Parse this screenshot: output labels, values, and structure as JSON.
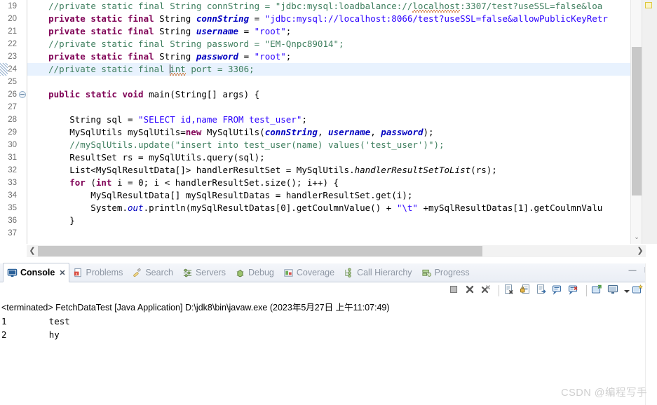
{
  "editor": {
    "first_visible_line_partial": "18",
    "cursor_line": "24",
    "lines": [
      {
        "num": "19",
        "fold": false,
        "changed": false,
        "highlight": false,
        "tokens": [
          {
            "t": "    ",
            "c": "plain"
          },
          {
            "t": "//private static final String connString = \"jdbc:mysql:loadbalance://",
            "c": "cmt"
          },
          {
            "t": "localhost",
            "c": "cmt spell"
          },
          {
            "t": ":3307/test?useSSL=false&loa",
            "c": "cmt"
          }
        ]
      },
      {
        "num": "20",
        "fold": false,
        "changed": false,
        "highlight": false,
        "tokens": [
          {
            "t": "    ",
            "c": "plain"
          },
          {
            "t": "private static final ",
            "c": "kw"
          },
          {
            "t": "String ",
            "c": "plain"
          },
          {
            "t": "connString",
            "c": "fld"
          },
          {
            "t": " = ",
            "c": "plain"
          },
          {
            "t": "\"jdbc:mysql://localhost:8066/test?useSSL=false&allowPublicKeyRetr",
            "c": "str"
          }
        ]
      },
      {
        "num": "21",
        "fold": false,
        "changed": false,
        "highlight": false,
        "tokens": [
          {
            "t": "    ",
            "c": "plain"
          },
          {
            "t": "private static final ",
            "c": "kw"
          },
          {
            "t": "String ",
            "c": "plain"
          },
          {
            "t": "username",
            "c": "fld"
          },
          {
            "t": " = ",
            "c": "plain"
          },
          {
            "t": "\"root\"",
            "c": "str"
          },
          {
            "t": ";",
            "c": "plain"
          }
        ]
      },
      {
        "num": "22",
        "fold": false,
        "changed": false,
        "highlight": false,
        "tokens": [
          {
            "t": "    ",
            "c": "plain"
          },
          {
            "t": "//private static final String password = \"EM-Qnpc89014\";",
            "c": "cmt"
          }
        ]
      },
      {
        "num": "23",
        "fold": false,
        "changed": false,
        "highlight": false,
        "tokens": [
          {
            "t": "    ",
            "c": "plain"
          },
          {
            "t": "private static final ",
            "c": "kw"
          },
          {
            "t": "String ",
            "c": "plain"
          },
          {
            "t": "password",
            "c": "fld"
          },
          {
            "t": " = ",
            "c": "plain"
          },
          {
            "t": "\"root\"",
            "c": "str"
          },
          {
            "t": ";",
            "c": "plain"
          }
        ]
      },
      {
        "num": "24",
        "fold": false,
        "changed": true,
        "highlight": true,
        "caret_after": 2,
        "tokens": [
          {
            "t": "    ",
            "c": "plain"
          },
          {
            "t": "//",
            "c": "cmt"
          },
          {
            "t": "private static final ",
            "c": "cmt"
          },
          {
            "t": "int",
            "c": "cmt spell"
          },
          {
            "t": " port = 3306;",
            "c": "cmt"
          }
        ]
      },
      {
        "num": "25",
        "fold": false,
        "changed": false,
        "highlight": false,
        "tokens": [
          {
            "t": "",
            "c": "plain"
          }
        ]
      },
      {
        "num": "26",
        "fold": true,
        "changed": false,
        "highlight": false,
        "tokens": [
          {
            "t": "    ",
            "c": "plain"
          },
          {
            "t": "public static void ",
            "c": "kw"
          },
          {
            "t": "main(String[] args) {",
            "c": "plain"
          }
        ]
      },
      {
        "num": "27",
        "fold": false,
        "changed": false,
        "highlight": false,
        "tokens": [
          {
            "t": "",
            "c": "plain"
          }
        ]
      },
      {
        "num": "28",
        "fold": false,
        "changed": false,
        "highlight": false,
        "tokens": [
          {
            "t": "        String sql = ",
            "c": "plain"
          },
          {
            "t": "\"SELECT id,name FROM test_user\"",
            "c": "str"
          },
          {
            "t": ";",
            "c": "plain"
          }
        ]
      },
      {
        "num": "29",
        "fold": false,
        "changed": false,
        "highlight": false,
        "tokens": [
          {
            "t": "        MySqlUtils mySqlUtils=",
            "c": "plain"
          },
          {
            "t": "new ",
            "c": "kw"
          },
          {
            "t": "MySqlUtils(",
            "c": "plain"
          },
          {
            "t": "connString",
            "c": "fld"
          },
          {
            "t": ", ",
            "c": "plain"
          },
          {
            "t": "username",
            "c": "fld"
          },
          {
            "t": ", ",
            "c": "plain"
          },
          {
            "t": "password",
            "c": "fld"
          },
          {
            "t": ");",
            "c": "plain"
          }
        ]
      },
      {
        "num": "30",
        "fold": false,
        "changed": false,
        "highlight": false,
        "tokens": [
          {
            "t": "        ",
            "c": "plain"
          },
          {
            "t": "//mySqlUtils.update(\"insert into test_user(name) values('test_user')\");",
            "c": "cmt"
          }
        ]
      },
      {
        "num": "31",
        "fold": false,
        "changed": false,
        "highlight": false,
        "tokens": [
          {
            "t": "        ResultSet rs = mySqlUtils.query(sql);",
            "c": "plain"
          }
        ]
      },
      {
        "num": "32",
        "fold": false,
        "changed": false,
        "highlight": false,
        "tokens": [
          {
            "t": "        List<MySqlResultData[]> handlerResultSet = MySqlUtils.",
            "c": "plain"
          },
          {
            "t": "handlerResultSetToList",
            "c": "mth"
          },
          {
            "t": "(rs);",
            "c": "plain"
          }
        ]
      },
      {
        "num": "33",
        "fold": false,
        "changed": false,
        "highlight": false,
        "tokens": [
          {
            "t": "        ",
            "c": "plain"
          },
          {
            "t": "for ",
            "c": "kw"
          },
          {
            "t": "(",
            "c": "plain"
          },
          {
            "t": "int ",
            "c": "kw"
          },
          {
            "t": "i = 0; i < handlerResultSet.size(); i++) {",
            "c": "plain"
          }
        ]
      },
      {
        "num": "34",
        "fold": false,
        "changed": false,
        "highlight": false,
        "tokens": [
          {
            "t": "            MySqlResultData[] mySqlResultDatas = handlerResultSet.get(i);",
            "c": "plain"
          }
        ]
      },
      {
        "num": "35",
        "fold": false,
        "changed": false,
        "highlight": false,
        "tokens": [
          {
            "t": "            System.",
            "c": "plain"
          },
          {
            "t": "out",
            "c": "stat"
          },
          {
            "t": ".println(mySqlResultDatas[0].getCoulmnValue() + ",
            "c": "plain"
          },
          {
            "t": "\"\\t\"",
            "c": "str"
          },
          {
            "t": " +mySqlResultDatas[1].getCoulmnValu",
            "c": "plain"
          }
        ]
      },
      {
        "num": "36",
        "fold": false,
        "changed": false,
        "highlight": false,
        "tokens": [
          {
            "t": "        }",
            "c": "plain"
          }
        ]
      },
      {
        "num": "37",
        "fold": false,
        "changed": false,
        "highlight": false,
        "tokens": [
          {
            "t": "",
            "c": "plain"
          }
        ]
      }
    ],
    "scroll": {
      "h_left_arrow": "❮",
      "h_right_arrow": "❯",
      "v_down_arrow": "⌄"
    }
  },
  "console_view": {
    "tabs": [
      {
        "label": "Console",
        "icon": "console-icon",
        "active": true,
        "closable": true,
        "close_glyph": "✕"
      },
      {
        "label": "Problems",
        "icon": "problems-icon",
        "active": false,
        "closable": false
      },
      {
        "label": "Search",
        "icon": "search-icon",
        "active": false,
        "closable": false
      },
      {
        "label": "Servers",
        "icon": "servers-icon",
        "active": false,
        "closable": false
      },
      {
        "label": "Debug",
        "icon": "debug-icon",
        "active": false,
        "closable": false
      },
      {
        "label": "Coverage",
        "icon": "coverage-icon",
        "active": false,
        "closable": false
      },
      {
        "label": "Call Hierarchy",
        "icon": "call-hierarchy-icon",
        "active": false,
        "closable": false
      },
      {
        "label": "Progress",
        "icon": "progress-icon",
        "active": false,
        "closable": false
      }
    ],
    "window_buttons": [
      {
        "name": "minimize-button",
        "glyph": "—"
      },
      {
        "name": "maximize-button",
        "glyph": "❐"
      }
    ],
    "toolbar_buttons": [
      {
        "name": "terminate-button",
        "icon": "stop-square-icon"
      },
      {
        "name": "remove-launch-button",
        "icon": "x-icon"
      },
      {
        "name": "remove-all-terminated-button",
        "icon": "double-x-icon"
      },
      {
        "name": "separator-1",
        "icon": "separator"
      },
      {
        "name": "clear-console-button",
        "icon": "clear-console-icon"
      },
      {
        "name": "scroll-lock-button",
        "icon": "lock-icon"
      },
      {
        "name": "pin-console-button",
        "icon": "pin-console-icon"
      },
      {
        "name": "show-console-on-output-button",
        "icon": "console-out-icon"
      },
      {
        "name": "show-console-on-error-button",
        "icon": "console-err-icon"
      },
      {
        "name": "separator-2",
        "icon": "separator"
      },
      {
        "name": "open-console-button",
        "icon": "open-console-icon"
      },
      {
        "name": "display-selected-console-button",
        "icon": "display-console-icon"
      },
      {
        "name": "display-selected-console-menu",
        "icon": "chevron-down-icon"
      },
      {
        "name": "new-console-view-button",
        "icon": "new-console-icon"
      },
      {
        "name": "new-console-view-menu",
        "icon": "chevron-down-icon"
      }
    ],
    "output": {
      "header": "<terminated> FetchDataTest [Java Application] D:\\jdk8\\bin\\javaw.exe (2023年5月27日 上午11:07:49)",
      "lines": [
        "1        test",
        "2        hy"
      ]
    }
  },
  "watermark": "CSDN @编程写手",
  "colors": {
    "keyword": "#7f0055",
    "string": "#2a00ff",
    "comment": "#3f7f5f",
    "field": "#0000c0",
    "highlight_line": "#e8f2fe",
    "tab_inactive_text": "#8d96a3",
    "warning_marker": "#ddc83e"
  }
}
